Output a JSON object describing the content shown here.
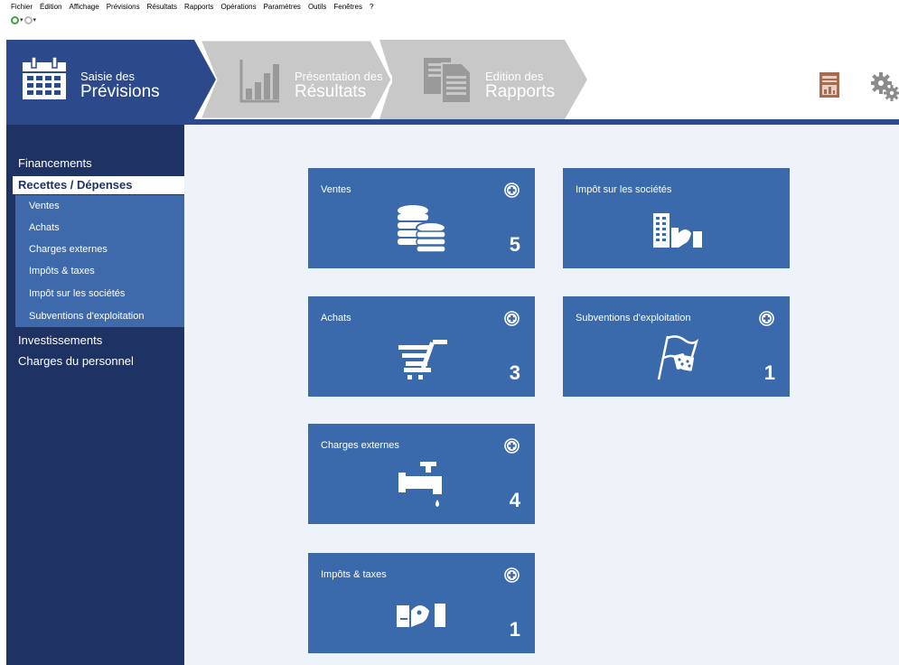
{
  "menu": {
    "items": [
      "Fichier",
      "Édition",
      "Affichage",
      "Prévisions",
      "Résultats",
      "Rapports",
      "Opérations",
      "Paramètres",
      "Outils",
      "Fenêtres",
      "?"
    ]
  },
  "quickbar": {
    "buttons": [
      {
        "icon": "green-circle-icon",
        "dropdown": "▾"
      },
      {
        "icon": "grey-circle-icon",
        "dropdown": "▾"
      }
    ]
  },
  "workflow": {
    "steps": [
      {
        "line1": "Saisie des",
        "line2": "Prévisions",
        "icon": "calendar-icon",
        "state": "active",
        "color": "#2c4a8b"
      },
      {
        "line1": "Présentation des",
        "line2": "Résultats",
        "icon": "bar-chart-icon",
        "state": "inactive",
        "color": "#c8c8c8"
      },
      {
        "line1": "Edition des",
        "line2": "Rapports",
        "icon": "documents-icon",
        "state": "inactive",
        "color": "#c8c8c8"
      }
    ],
    "tools": [
      {
        "icon": "report-calculator-icon",
        "color": "#a86b50"
      },
      {
        "icon": "gears-icon",
        "color": "#8c8c8c"
      }
    ]
  },
  "sidebar": {
    "items": [
      {
        "label": "Financements",
        "level": "top",
        "active": false
      },
      {
        "label": "Recettes / Dépenses",
        "level": "top",
        "active": true
      },
      {
        "label": "Ventes",
        "level": "sub"
      },
      {
        "label": "Achats",
        "level": "sub"
      },
      {
        "label": "Charges externes",
        "level": "sub"
      },
      {
        "label": "Impôts & taxes",
        "level": "sub"
      },
      {
        "label": "Impôt sur les sociétés",
        "level": "sub"
      },
      {
        "label": "Subventions d'exploitation",
        "level": "sub"
      },
      {
        "label": "Investissements",
        "level": "top",
        "active": false
      },
      {
        "label": "Charges du personnel",
        "level": "top",
        "active": false
      }
    ]
  },
  "cards": [
    {
      "title": "Ventes",
      "count": "5",
      "icon": "coins-icon",
      "has_add": true
    },
    {
      "title": "Impôt sur les sociétés",
      "count": "",
      "icon": "tax-building-icon",
      "has_add": false
    },
    {
      "title": "Achats",
      "count": "3",
      "icon": "shopping-cart-icon",
      "has_add": true
    },
    {
      "title": "Subventions d'exploitation",
      "count": "1",
      "icon": "subsidy-flag-icon",
      "has_add": true
    },
    {
      "title": "Charges externes",
      "count": "4",
      "icon": "water-tap-icon",
      "has_add": true
    },
    {
      "title": "Impôts & taxes",
      "count": "1",
      "icon": "tax-stamp-icon",
      "has_add": true
    }
  ],
  "colors": {
    "sidebar_bg": "#1e3264",
    "subpanel_bg": "#3e6aab",
    "card_bg": "#3a6aab",
    "main_bg": "#eef3fa"
  }
}
